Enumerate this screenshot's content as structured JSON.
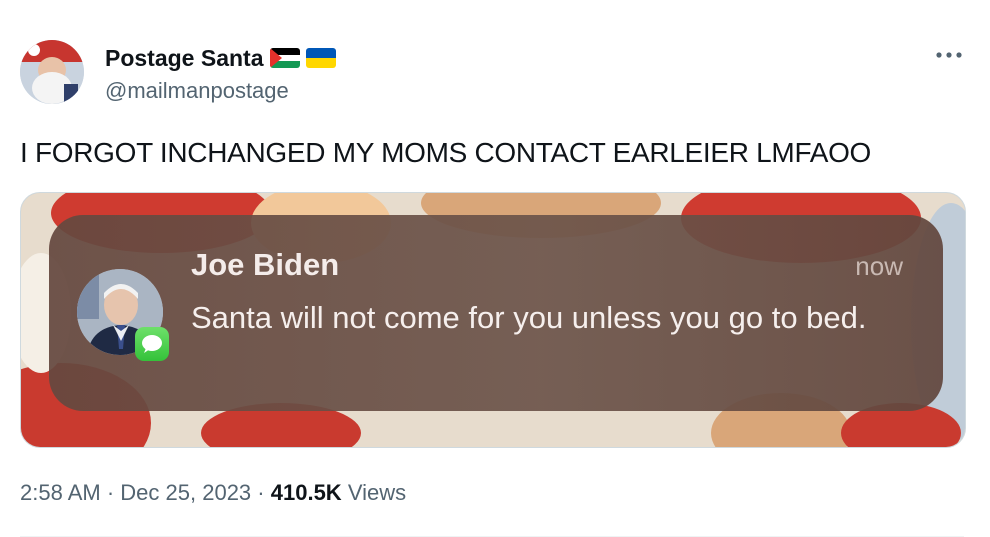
{
  "author": {
    "display_name": "Postage Santa",
    "handle": "@mailmanpostage",
    "flags": [
      "palestine-flag-icon",
      "ukraine-flag-icon"
    ]
  },
  "tweet": {
    "text": "I FORGOT INCHANGED MY MOMS CONTACT EARLEIER LMFAOO"
  },
  "notification": {
    "sender": "Joe Biden",
    "time": "now",
    "message": "Santa will not come for you unless you go to bed.",
    "app_icon": "imessage-icon"
  },
  "meta": {
    "time": "2:58 AM",
    "separator": "·",
    "date": "Dec 25, 2023",
    "views_count": "410.5K",
    "views_label": "Views"
  },
  "colors": {
    "notification_bg": "#6b4d43",
    "secondary_text": "#536471",
    "imessage_green": "#34c23a"
  }
}
